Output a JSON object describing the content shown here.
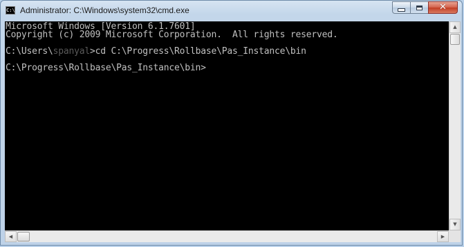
{
  "window": {
    "title": "Administrator: C:\\Windows\\system32\\cmd.exe",
    "icon_label": "C:\\",
    "caption_buttons": {
      "minimize": "minimize-icon",
      "maximize": "maximize-icon",
      "close": "close-icon",
      "close_glyph": "✕"
    }
  },
  "console": {
    "lines": [
      "Microsoft Windows [Version 6.1.7601]",
      "Copyright (c) 2009 Microsoft Corporation.  All rights reserved.",
      "",
      "C:\\Users\\",
      "",
      "C:\\Progress\\Rollbase\\Pas_Instance\\bin>"
    ],
    "redacted_username": "spanyal",
    "command_after_user": ">cd C:\\Progress\\Rollbase\\Pas_Instance\\bin"
  },
  "scrollbars": {
    "up_glyph": "▲",
    "down_glyph": "▼",
    "left_glyph": "◀",
    "right_glyph": "▶"
  },
  "colors": {
    "console_background": "#000000",
    "console_text": "#c0c0c0",
    "close_button": "#c23d24"
  }
}
